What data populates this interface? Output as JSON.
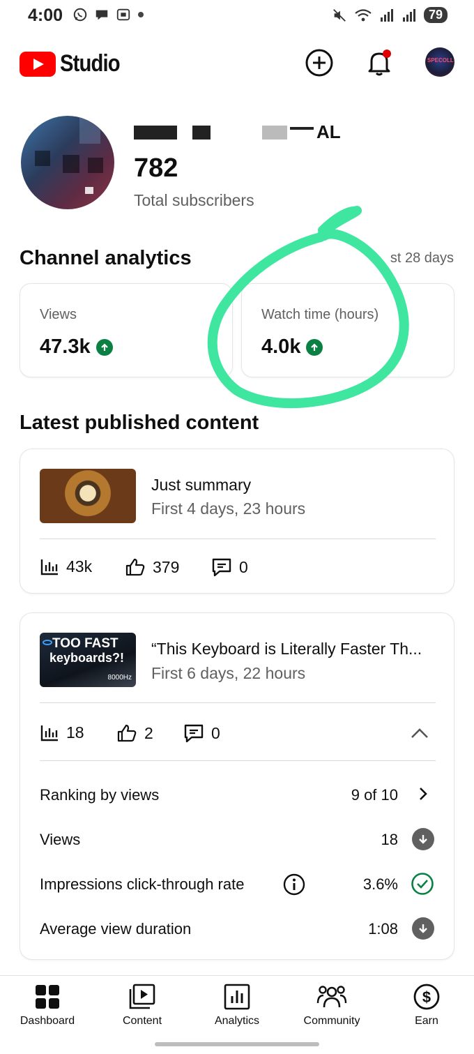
{
  "status_bar": {
    "time": "4:00",
    "battery": "79"
  },
  "header": {
    "logo_text": "Studio"
  },
  "channel": {
    "name_suffix": "AL",
    "subscribers": "782",
    "subscribers_label": "Total subscribers"
  },
  "analytics": {
    "title": "Channel analytics",
    "period": "st 28 days",
    "cards": [
      {
        "label": "Views",
        "value": "47.3k"
      },
      {
        "label": "Watch time (hours)",
        "value": "4.0k"
      }
    ]
  },
  "latest": {
    "title": "Latest published content",
    "videos": [
      {
        "title": "Just summary",
        "subtitle": "First 4 days, 23 hours",
        "views": "43k",
        "likes": "379",
        "comments": "0"
      },
      {
        "title": "“This Keyboard is Literally Faster Th...",
        "subtitle": "First 6 days, 22 hours",
        "thumb_line1": "TOO FAST",
        "thumb_line2": "keyboards?!",
        "thumb_line3": "8000Hz",
        "views": "18",
        "likes": "2",
        "comments": "0",
        "details": {
          "ranking_label": "Ranking by views",
          "ranking_value": "9 of 10",
          "views_label": "Views",
          "views_value": "18",
          "ctr_label": "Impressions click-through rate",
          "ctr_value": "3.6%",
          "avd_label": "Average view duration",
          "avd_value": "1:08"
        }
      }
    ]
  },
  "bottom_nav": {
    "items": [
      "Dashboard",
      "Content",
      "Analytics",
      "Community",
      "Earn"
    ]
  },
  "colors": {
    "brand_red": "#ff0000",
    "up_green": "#0b8043",
    "scribble": "#3ee6a0"
  }
}
